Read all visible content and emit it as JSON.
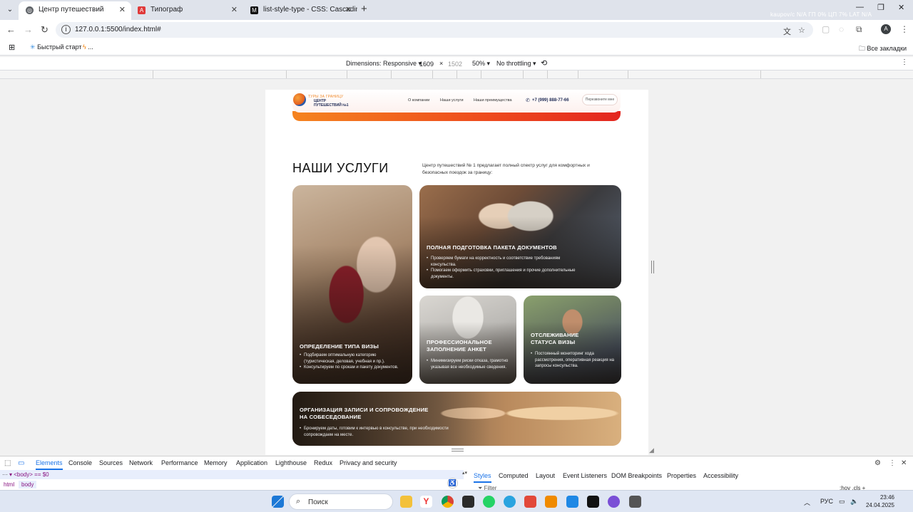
{
  "browser": {
    "tabs": [
      {
        "title": "Центр путешествий",
        "active": true
      },
      {
        "title": "Типограф",
        "active": false
      },
      {
        "title": "list-style-type - CSS: Cascading",
        "active": false
      }
    ],
    "new_tab": "+",
    "url": "127.0.0.1:5500/index.html#",
    "profile_initial": "A",
    "netstat": "kaupov/c  N/A  ГП  0%  ЦП  7%  LAT  N/A",
    "bookmarks": {
      "quick_start": "Быстрый старт",
      "more": "...",
      "all": "Все закладки"
    }
  },
  "device_toolbar": {
    "dimensions_label": "Dimensions: Responsive ▾",
    "width": "1609",
    "times": "×",
    "height": "1502",
    "zoom": "50% ▾",
    "throttling": "No throttling ▾"
  },
  "site": {
    "logo_small": "ТУРЫ ЗА ГРАНИЦУ",
    "logo_line1": "ЦЕНТР",
    "logo_line2": "ПУТЕШЕСТВИЙ №1",
    "nav": [
      "О компании",
      "Наши услуги",
      "Наши преимущества"
    ],
    "phone": "+7 (999) 888-77-66",
    "callback": "Перезвоните мне",
    "section_title": "НАШИ УСЛУГИ",
    "section_desc": "Центр путешествий № 1 предлагает полный спектр услуг для комфортных и безопасных поездок за границу:",
    "cards": [
      {
        "title": "ОПРЕДЕЛЕНИЕ ТИПА ВИЗЫ",
        "items": [
          "Подбираем оптимальную категорию (туристическая, деловая, учебная и пр.).",
          "Консультируем по срокам и пакету документов."
        ]
      },
      {
        "title": "ПОЛНАЯ ПОДГОТОВКА ПАКЕТА ДОКУМЕНТОВ",
        "items": [
          "Проверяем бумаги на корректность и соответствие требованиям консульства.",
          "Помогаем оформить страховки, приглашения и прочие дополнительные документы."
        ]
      },
      {
        "title_line1": "ПРОФЕССИОНАЛЬНОЕ",
        "title_line2": "ЗАПОЛНЕНИЕ АНКЕТ",
        "items": [
          "Минимизируем риски отказа, грамотно указывая все необходимые сведения."
        ]
      },
      {
        "title_line1": "ОТСЛЕЖИВАНИЕ",
        "title_line2": "СТАТУСА ВИЗЫ",
        "items": [
          "Постоянный мониторинг хода рассмотрения, оперативная реакция на запросы консульства."
        ]
      },
      {
        "title_line1": "ОРГАНИЗАЦИЯ ЗАПИСИ И СОПРОВОЖДЕНИЕ",
        "title_line2": "НА СОБЕСЕДОВАНИЕ",
        "items": [
          "Бронируем даты, готовим к интервью в консульстве, при необходимости сопровождаем на месте."
        ]
      }
    ]
  },
  "devtools": {
    "tabs": [
      "Elements",
      "Console",
      "Sources",
      "Network",
      "Performance",
      "Memory",
      "Application",
      "Lighthouse",
      "Redux",
      "Privacy and security"
    ],
    "dom_line": "▾ <body> == $0",
    "dom_prefix": "···",
    "breadcrumbs": [
      "html",
      "body"
    ],
    "styles_tabs": [
      "Styles",
      "Computed",
      "Layout",
      "Event Listeners",
      "DOM Breakpoints",
      "Properties",
      "Accessibility"
    ],
    "filter": "Filter",
    "filter_right": ":hov  .cls  +"
  },
  "taskbar": {
    "search": "Поиск",
    "lang": "РУС",
    "time": "23:46",
    "date": "24.04.2025"
  }
}
